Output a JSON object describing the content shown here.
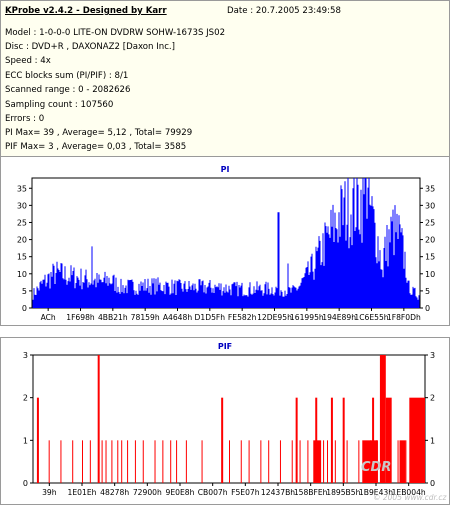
{
  "info": {
    "title": "KProbe v2.4.2 - Designed by Karr",
    "date": "Date : 20.7.2005 23:49:58",
    "lines": [
      "Model : 1-0-0-0 LITE-ON DVDRW SOHW-1673S JS02",
      "Disc : DVD+R , DAXONAZ2 [Daxon Inc.]",
      "Speed : 4x",
      "ECC blocks sum (PI/PIF) : 8/1",
      "Scanned range : 0 - 2082626",
      "Sampling count : 107560",
      "Errors : 0",
      "PI Max= 39 , Average= 5,12 , Total= 79929",
      "PIF Max= 3 , Average= 0,03 , Total= 3585"
    ]
  },
  "watermark": {
    "text": "CDR",
    "url": "© 2005 www.cdr.cz"
  },
  "colors": {
    "pi": "#0000ff",
    "pif": "#ff0000",
    "title": "#0000c0",
    "info_bg": "#fffff0"
  },
  "chart_data": [
    {
      "type": "area",
      "title": "PI",
      "ylim": [
        0,
        38
      ],
      "yticks": [
        0,
        5,
        10,
        15,
        20,
        25,
        30,
        35
      ],
      "xticks": [
        "ACh",
        "1F698h",
        "4BB21h",
        "78159h",
        "A4648h",
        "D1D5Fh",
        "FE582h",
        "12DE95h",
        "161995h",
        "194E89h",
        "1C6E55h",
        "1F8F0Dh"
      ],
      "grid": false,
      "profile": [
        [
          0,
          4
        ],
        [
          0.03,
          8
        ],
        [
          0.06,
          11
        ],
        [
          0.1,
          10
        ],
        [
          0.14,
          9
        ],
        [
          0.18,
          8
        ],
        [
          0.2,
          9
        ],
        [
          0.23,
          6.5
        ],
        [
          0.28,
          7
        ],
        [
          0.33,
          7
        ],
        [
          0.38,
          6.5
        ],
        [
          0.43,
          6.5
        ],
        [
          0.48,
          6.5
        ],
        [
          0.53,
          6
        ],
        [
          0.58,
          6
        ],
        [
          0.62,
          6
        ],
        [
          0.65,
          6
        ],
        [
          0.67,
          5
        ],
        [
          0.69,
          7
        ],
        [
          0.72,
          12
        ],
        [
          0.75,
          19
        ],
        [
          0.78,
          26
        ],
        [
          0.8,
          30
        ],
        [
          0.83,
          33
        ],
        [
          0.85,
          34
        ],
        [
          0.87,
          32
        ],
        [
          0.89,
          22
        ],
        [
          0.9,
          15
        ],
        [
          0.91,
          18
        ],
        [
          0.93,
          25
        ],
        [
          0.945,
          23
        ],
        [
          0.96,
          16
        ],
        [
          0.97,
          9
        ],
        [
          0.98,
          5
        ],
        [
          1,
          4
        ]
      ],
      "spikes": [
        [
          0.155,
          18
        ],
        [
          0.635,
          28
        ],
        [
          0.66,
          13
        ],
        [
          0.86,
          39
        ],
        [
          0.905,
          9
        ],
        [
          0.97,
          8
        ]
      ]
    },
    {
      "type": "bar",
      "title": "PIF",
      "ylim": [
        0,
        3
      ],
      "yticks": [
        0,
        1,
        2,
        3
      ],
      "xticks": [
        "39h",
        "1E01Eh",
        "48278h",
        "72900h",
        "9E0E8h",
        "CB007h",
        "F5E07h",
        "12437Bh",
        "158BFEh",
        "1895B5h",
        "1B9E43h",
        "1EB004h"
      ],
      "grid": false,
      "bars": [
        [
          0.01,
          2
        ],
        [
          0.04,
          1
        ],
        [
          0.07,
          1
        ],
        [
          0.1,
          1
        ],
        [
          0.125,
          1
        ],
        [
          0.145,
          1
        ],
        [
          0.165,
          3
        ],
        [
          0.175,
          1
        ],
        [
          0.185,
          1
        ],
        [
          0.2,
          1
        ],
        [
          0.215,
          1
        ],
        [
          0.225,
          1
        ],
        [
          0.24,
          1
        ],
        [
          0.26,
          1
        ],
        [
          0.28,
          1
        ],
        [
          0.31,
          1
        ],
        [
          0.33,
          1
        ],
        [
          0.35,
          1
        ],
        [
          0.365,
          1
        ],
        [
          0.39,
          1
        ],
        [
          0.43,
          1
        ],
        [
          0.48,
          2
        ],
        [
          0.5,
          1
        ],
        [
          0.53,
          1
        ],
        [
          0.55,
          1
        ],
        [
          0.58,
          1
        ],
        [
          0.6,
          1
        ],
        [
          0.63,
          1
        ],
        [
          0.66,
          1
        ],
        [
          0.68,
          1
        ],
        [
          0.7,
          1
        ],
        [
          0.72,
          2
        ],
        [
          0.74,
          1
        ],
        [
          0.75,
          1
        ],
        [
          0.77,
          1
        ],
        [
          0.8,
          1
        ],
        [
          0.83,
          1
        ],
        [
          0.86,
          1
        ],
        [
          0.875,
          1
        ],
        [
          0.89,
          1
        ],
        [
          0.91,
          1
        ],
        [
          0.93,
          1
        ],
        [
          0.95,
          1
        ],
        [
          0.965,
          1
        ],
        [
          0.98,
          1
        ],
        [
          0.995,
          1
        ],
        [
          0.67,
          2
        ],
        [
          0.76,
          2
        ],
        [
          0.79,
          2
        ],
        [
          0.865,
          2
        ]
      ],
      "dense_regions": [
        {
          "from": 0.715,
          "to": 0.735,
          "value": 1
        },
        {
          "from": 0.84,
          "to": 0.88,
          "value": 1
        },
        {
          "from": 0.885,
          "to": 0.9,
          "value": 3
        },
        {
          "from": 0.9,
          "to": 0.915,
          "value": 2
        },
        {
          "from": 0.935,
          "to": 0.95,
          "value": 1
        },
        {
          "from": 0.96,
          "to": 1.0,
          "value": 2
        }
      ]
    }
  ]
}
